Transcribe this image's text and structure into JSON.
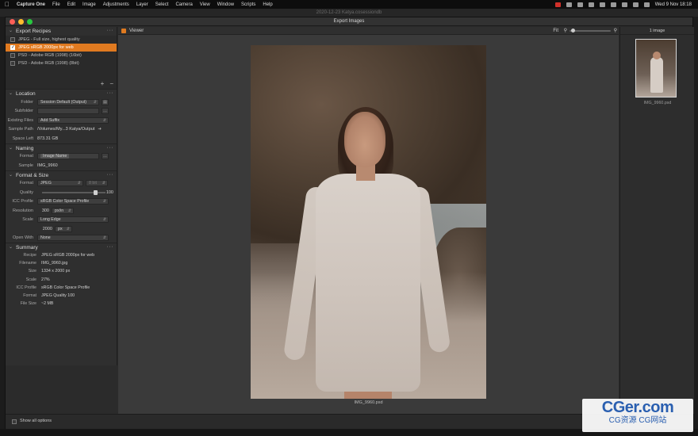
{
  "menubar": {
    "app_name": "Capture One",
    "items": [
      "File",
      "Edit",
      "Image",
      "Adjustments",
      "Layer",
      "Select",
      "Camera",
      "View",
      "Window",
      "Scripts",
      "Help"
    ],
    "clock": "Wed 9 Nov  18:18"
  },
  "document_title": "2020-12-23 Katya.cosessiondb",
  "dialog": {
    "title": "Export Images"
  },
  "export_recipes": {
    "title": "Export Recipes",
    "items": [
      {
        "label": "JPEG - Full size, highest quality",
        "checked": false,
        "selected": false
      },
      {
        "label": "JPEG sRGB 2000px for web",
        "checked": true,
        "selected": true
      },
      {
        "label": "PSD - Adobe RGB (1998) (16bit)",
        "checked": false,
        "selected": false
      },
      {
        "label": "PSD - Adobe RGB (1998) (8bit)",
        "checked": false,
        "selected": false
      }
    ],
    "add": "+",
    "remove": "−"
  },
  "location": {
    "title": "Location",
    "folder_label": "Folder",
    "folder_value": "Session Default (Output)",
    "subfolder_label": "Subfolder",
    "subfolder_value": "",
    "existing_label": "Existing Files",
    "existing_value": "Add Suffix",
    "sample_path_label": "Sample Path",
    "sample_path_value": "/Volumes/My...3 Katya/Output",
    "space_left_label": "Space Left",
    "space_left_value": "873.31 GB"
  },
  "naming": {
    "title": "Naming",
    "format_label": "Format",
    "format_value": "Image Name",
    "sample_label": "Sample",
    "sample_value": "IMG_9960"
  },
  "format_size": {
    "title": "Format & Size",
    "format_label": "Format",
    "format_value": "JPEG",
    "bit_value": "8 bit",
    "quality_label": "Quality",
    "quality_value": "100",
    "icc_label": "ICC Profile",
    "icc_value": "sRGB Color Space Profile",
    "resolution_label": "Resolution",
    "resolution_value": "300",
    "resolution_unit": "px/in",
    "scale_label": "Scale",
    "scale_value": "Long Edge",
    "size_value": "2000",
    "size_unit": "px",
    "open_with_label": "Open With",
    "open_with_value": "None"
  },
  "summary": {
    "title": "Summary",
    "rows": [
      {
        "label": "Recipe",
        "value": "JPEG sRGB 2000px for web"
      },
      {
        "label": "Filename",
        "value": "IMG_9960.jpg"
      },
      {
        "label": "Size",
        "value": "1334 x 2000 px"
      },
      {
        "label": "Scale",
        "value": "27%"
      },
      {
        "label": "ICC Profile",
        "value": "sRGB Color Space Profile"
      },
      {
        "label": "Format",
        "value": "JPEG Quality 100"
      },
      {
        "label": "File Size",
        "value": "~2 MB"
      }
    ]
  },
  "viewer": {
    "title": "Viewer",
    "fit_label": "Fit",
    "caption": "IMG_9960.psd"
  },
  "browser": {
    "count": "1 image",
    "thumb_name": "IMG_9960.psd"
  },
  "bottom": {
    "show_all_label": "Show all options"
  },
  "watermark": {
    "big": "CGer.com",
    "small": "CG资源 CG网站"
  },
  "colors": {
    "accent": "#e07a20",
    "panel": "#2f2f2f",
    "viewer_bg": "#3a3a3a"
  }
}
